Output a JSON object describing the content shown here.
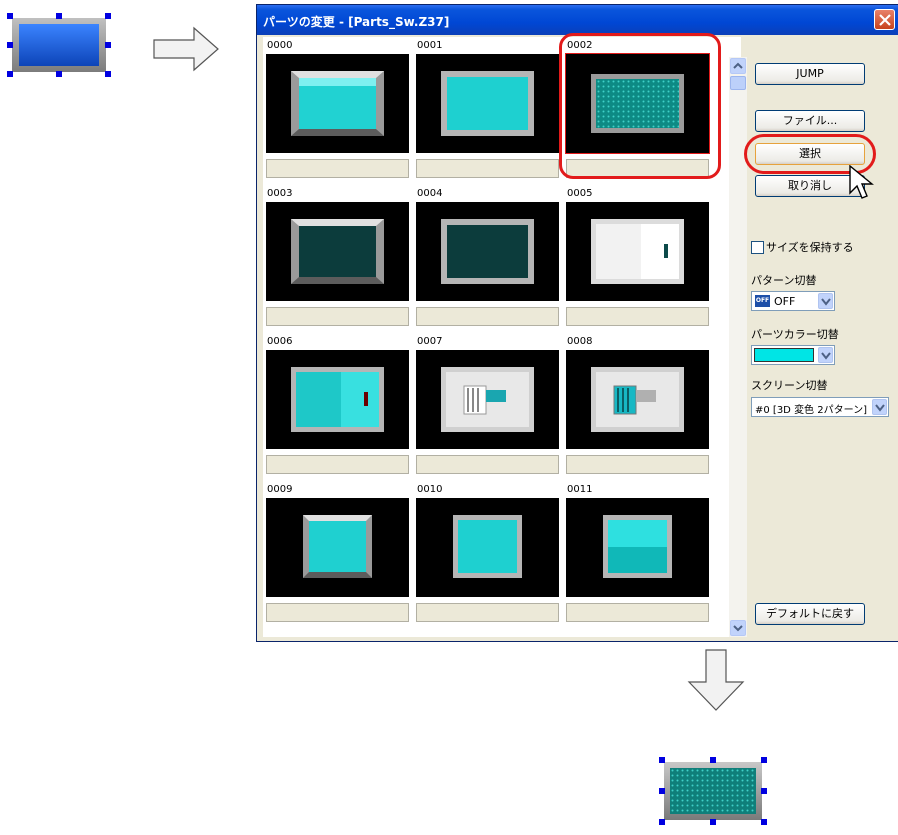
{
  "dialog": {
    "title": "パーツの変更 - [Parts_Sw.Z37]"
  },
  "parts": [
    {
      "id": "0000",
      "style": "cyan-bevel"
    },
    {
      "id": "0001",
      "style": "cyan-flat"
    },
    {
      "id": "0002",
      "style": "teal-dotted"
    },
    {
      "id": "0003",
      "style": "dark-bevel"
    },
    {
      "id": "0004",
      "style": "dark-flat"
    },
    {
      "id": "0005",
      "style": "white-toggle"
    },
    {
      "id": "0006",
      "style": "cyan-toggle"
    },
    {
      "id": "0007",
      "style": "slide-switch"
    },
    {
      "id": "0008",
      "style": "slide-switch-cyan"
    },
    {
      "id": "0009",
      "style": "cyan-small"
    },
    {
      "id": "0010",
      "style": "cyan-small-flat"
    },
    {
      "id": "0011",
      "style": "cyan-split"
    }
  ],
  "buttons": {
    "jump": "JUMP",
    "file": "ファイル...",
    "select": "選択",
    "cancel": "取り消し",
    "default": "デフォルトに戻す"
  },
  "options": {
    "keep_size": "サイズを保持する",
    "pattern_label": "パターン切替",
    "pattern_value": "OFF",
    "pattern_icon": "OFF",
    "parts_color_label": "パーツカラー切替",
    "parts_color_value": "#00e5e5",
    "screen_label": "スクリーン切替",
    "screen_value": "#0 [3D 変色 2パターン]"
  },
  "colors": {
    "highlight": "#e21b1b",
    "selection_handle": "#0000e0",
    "before_part": "#1a5fd0",
    "after_part": "#0f7f7a"
  }
}
